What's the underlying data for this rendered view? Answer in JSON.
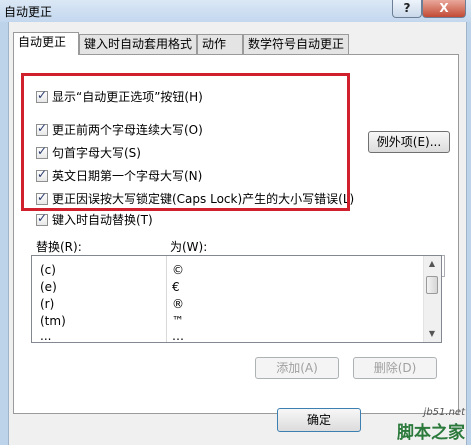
{
  "window": {
    "title": "自动更正",
    "help_label": "?",
    "close_label": "X"
  },
  "tabs": [
    {
      "label": "自动更正",
      "active": true
    },
    {
      "label": "键入时自动套用格式",
      "active": false
    },
    {
      "label": "动作",
      "active": false
    },
    {
      "label": "数学符号自动更正",
      "active": false
    }
  ],
  "options": {
    "show_buttons": {
      "label": "显示“自动更正选项”按钮(H)",
      "checked": true
    },
    "highlighted": [
      {
        "label": "更正前两个字母连续大写(O)",
        "checked": true
      },
      {
        "label": "句首字母大写(S)",
        "checked": true
      },
      {
        "label": "英文日期第一个字母大写(N)",
        "checked": true
      },
      {
        "label": "更正因误按大写锁定键(Caps Lock)产生的大小写错误(L)",
        "checked": true
      },
      {
        "label": "键入时自动替换(T)",
        "checked": true
      }
    ]
  },
  "exceptions_button": "例外项(E)...",
  "replace": {
    "label": "替换(R):",
    "value": ""
  },
  "with": {
    "label": "为(W):",
    "value": ""
  },
  "entries": [
    {
      "replace": "(c)",
      "with": "©"
    },
    {
      "replace": "(e)",
      "with": "€"
    },
    {
      "replace": "(r)",
      "with": "®"
    },
    {
      "replace": "(tm)",
      "with": "™"
    },
    {
      "replace": "...",
      "with": "…"
    }
  ],
  "buttons": {
    "add": "添加(A)",
    "delete": "删除(D)",
    "ok": "确定"
  },
  "watermark": {
    "url": "jb51.net",
    "name": "脚本之家"
  },
  "colors": {
    "highlight_frame": "#d0202e",
    "watermark_green": "#2b7a3c"
  }
}
